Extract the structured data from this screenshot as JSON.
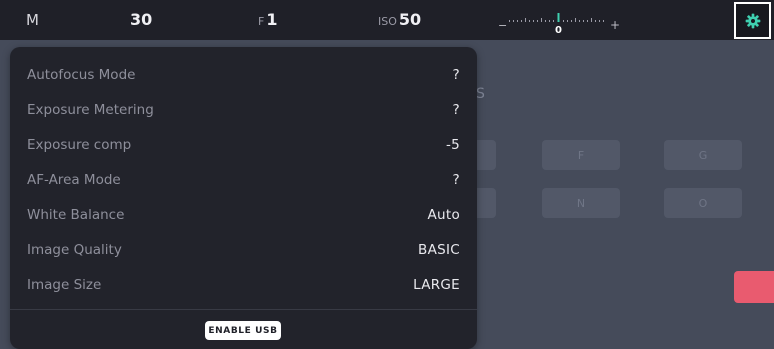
{
  "topbar": {
    "mode": "M",
    "shutter": "30",
    "aperture_prefix": "F",
    "aperture": "1",
    "iso_prefix": "ISO",
    "iso": "50",
    "exposure_minus": "−",
    "exposure_zero": "0",
    "exposure_plus": "+",
    "settings_icon": "gear-icon"
  },
  "background": {
    "fragment": "S",
    "keys_row1": [
      "F",
      "G"
    ],
    "keys_row2": [
      "N",
      "O"
    ]
  },
  "panel": {
    "rows": [
      {
        "label": "Autofocus Mode",
        "value": "?"
      },
      {
        "label": "Exposure Metering",
        "value": "?"
      },
      {
        "label": "Exposure comp",
        "value": "-5"
      },
      {
        "label": "AF-Area Mode",
        "value": "?"
      },
      {
        "label": "White Balance",
        "value": "Auto"
      },
      {
        "label": "Image Quality",
        "value": "BASIC"
      },
      {
        "label": "Image Size",
        "value": "LARGE"
      }
    ],
    "usb_button": "ENABLE USB"
  },
  "colors": {
    "accent": "#3fd0b0",
    "topbar_bg": "#1f2028",
    "panel_bg": "#22232b",
    "app_bg": "#454b5a",
    "red_button": "#e95b6f"
  }
}
